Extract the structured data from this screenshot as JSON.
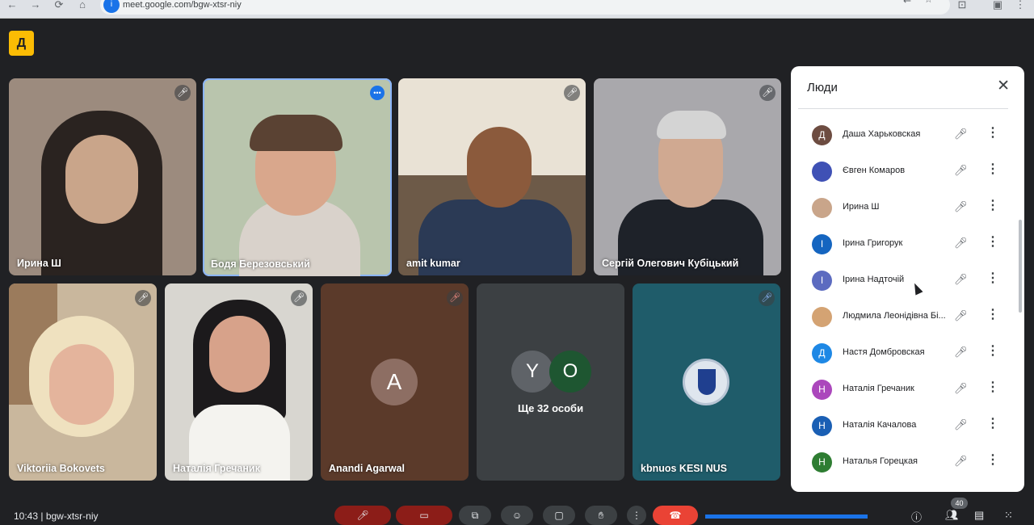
{
  "browser": {
    "url": "meet.google.com/bgw-xtsr-niy",
    "back_icon": "←",
    "forward_icon": "→",
    "reload_icon": "⟳",
    "home_icon": "⌂",
    "translate_icon": "⇄",
    "star_icon": "☆",
    "extensions_icon": "⊡",
    "menu_icon": "⋮"
  },
  "meet": {
    "logo_letter": "Д"
  },
  "tiles": [
    {
      "name": "Ирина Ш",
      "bg": "#9c8b7e",
      "muted": true
    },
    {
      "name": "Бодя Березовський",
      "bg": "#b9c5ad",
      "speaking": true
    },
    {
      "name": "amit kumar",
      "bg": "#6d5a48",
      "muted": true
    },
    {
      "name": "Сергій Олегович Кубіцький",
      "bg": "#a9a8ac",
      "muted": true
    },
    {
      "name": "Viktoriia Bokovets",
      "bg": "#c9b79d",
      "muted": true
    },
    {
      "name": "Наталія Гречаник",
      "bg": "#d8d6d0",
      "muted": true
    },
    {
      "name": "Anandi Agarwal",
      "avatar": "A",
      "bg": "#5b3a2a",
      "muted": true
    },
    {
      "more_label": "Ще 32 особи",
      "avatars": [
        "Y",
        "O"
      ],
      "bg": "#3c4043"
    },
    {
      "name": "kbnuos KESI NUS",
      "bg": "#1f5c6a",
      "muted": true
    }
  ],
  "panel": {
    "title": "Люди",
    "close_icon": "✕",
    "people": [
      {
        "initial": "Д",
        "name": "Даша Харьковская",
        "color": "#6d4c41"
      },
      {
        "initial": "",
        "name": "Євген Комаров",
        "color": "#3f51b5",
        "photo": true
      },
      {
        "initial": "",
        "name": "Ирина Ш",
        "color": "#c9a58a",
        "photo": true
      },
      {
        "initial": "І",
        "name": "Ірина Григорук",
        "color": "#1565c0"
      },
      {
        "initial": "І",
        "name": "Ірина Надточій",
        "color": "#5c6bc0"
      },
      {
        "initial": "",
        "name": "Людмила Леонідівна Бі...",
        "color": "#d4a373",
        "photo": true
      },
      {
        "initial": "Д",
        "name": "Настя Домбровская",
        "color": "#1e88e5"
      },
      {
        "initial": "Н",
        "name": "Наталія Гречаник",
        "color": "#ab47bc"
      },
      {
        "initial": "Н",
        "name": "Наталія Качалова",
        "color": "#1a5fb4"
      },
      {
        "initial": "Н",
        "name": "Наталья Горецкая",
        "color": "#2e7d32"
      }
    ]
  },
  "bottom": {
    "time": "10:43 | bgw-xtsr-niy",
    "people_count": "40"
  }
}
